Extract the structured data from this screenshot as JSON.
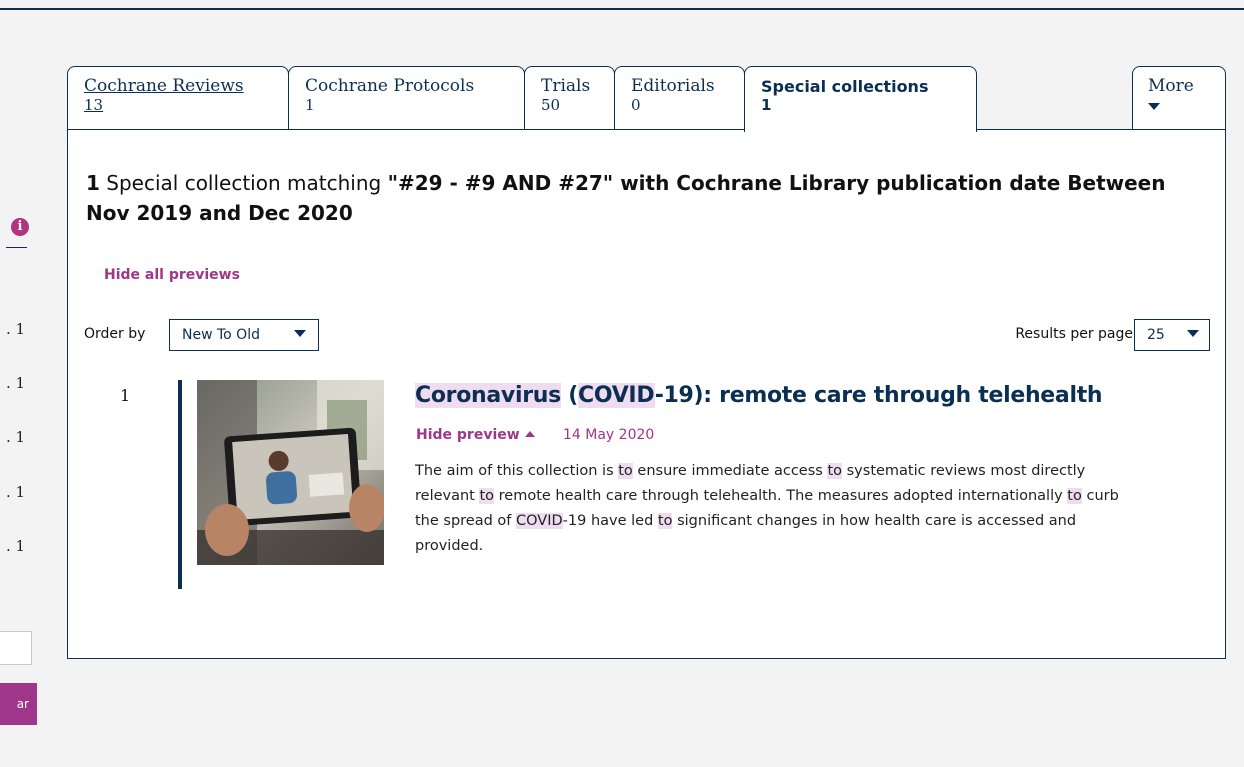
{
  "sidebar": {
    "counts": [
      ". 1",
      ". 1",
      ". 1",
      ". 1",
      ". 1"
    ],
    "button_label": "ar"
  },
  "tabs": [
    {
      "label": "Cochrane Reviews",
      "count": "13"
    },
    {
      "label": "Cochrane Protocols",
      "count": "1"
    },
    {
      "label": "Trials",
      "count": "50"
    },
    {
      "label": "Editorials",
      "count": "0"
    },
    {
      "label": "Special collections",
      "count": "1"
    },
    {
      "label": "More"
    }
  ],
  "results_heading": {
    "count": "1",
    "text": " Special collection matching ",
    "query": "\"#29 - #9 AND #27\"",
    "rest": " with Cochrane Library publication date Between Nov 2019 and Dec 2020"
  },
  "hide_all_previews": "Hide all previews",
  "order_by": {
    "label": "Order by",
    "value": "New To Old"
  },
  "results_per_page": {
    "label": "Results per page",
    "value": "25"
  },
  "result": {
    "number": "1",
    "title_parts": [
      "Coronavirus",
      " (",
      "COVID",
      "-19): remote care through telehealth"
    ],
    "hide_preview": "Hide preview",
    "date": "14 May 2020",
    "summary": [
      "The aim of this collection is ",
      "to",
      " ensure immediate access ",
      "to",
      " systematic reviews most directly relevant ",
      "to",
      " remote health care through telehealth. The measures adopted internationally ",
      "to",
      " curb the spread of ",
      "COVID",
      "-19 have led ",
      "to",
      " significant changes in how health care is accessed and provided."
    ]
  },
  "colors": {
    "navy": "#0b2f52",
    "magenta": "#a0368a",
    "highlight": "#f0dcf0"
  }
}
